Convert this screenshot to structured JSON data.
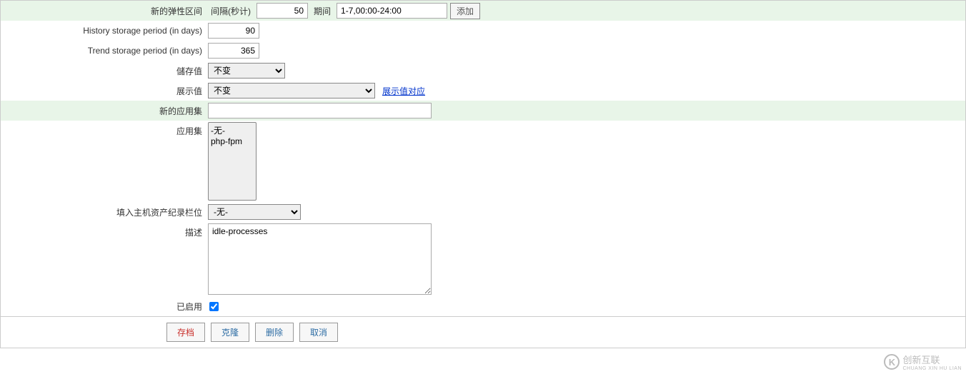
{
  "flex_interval": {
    "label": "新的弹性区间",
    "interval_label": "间隔(秒计)",
    "interval_value": "50",
    "period_label": "期间",
    "period_value": "1-7,00:00-24:00",
    "add_button": "添加"
  },
  "history_period": {
    "label": "History storage period (in days)",
    "value": "90"
  },
  "trend_period": {
    "label": "Trend storage period (in days)",
    "value": "365"
  },
  "store_value": {
    "label": "儲存值",
    "selected": "不变"
  },
  "show_value": {
    "label": "展示值",
    "selected": "不变",
    "link": "展示值对应"
  },
  "new_appset": {
    "label": "新的应用集",
    "value": ""
  },
  "appset": {
    "label": "应用集",
    "options": [
      "-无-",
      "php-fpm"
    ]
  },
  "host_inventory": {
    "label": "填入主机资产纪录栏位",
    "selected": "-无-"
  },
  "description": {
    "label": "描述",
    "value": "idle-processes"
  },
  "enabled": {
    "label": "已启用",
    "checked": true
  },
  "buttons": {
    "save": "存档",
    "clone": "克隆",
    "delete": "删除",
    "cancel": "取消"
  },
  "watermark": {
    "main": "创新互联",
    "sub": "CHUANG XIN HU LIAN"
  }
}
